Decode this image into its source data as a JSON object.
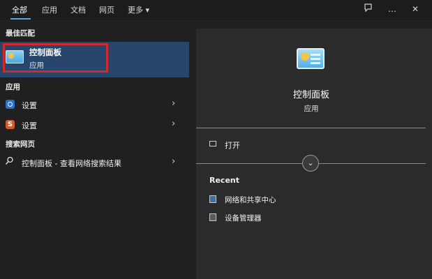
{
  "tabs": [
    {
      "label": "全部",
      "active": true
    },
    {
      "label": "应用"
    },
    {
      "label": "文档"
    },
    {
      "label": "网页"
    },
    {
      "label": "更多 ▾"
    }
  ],
  "top_icons": {
    "feedback_icon": "feedback-icon",
    "more_icon": "…",
    "close_icon": "✕"
  },
  "left": {
    "best_match_header": "最佳匹配",
    "best_match": {
      "title": "控制面板",
      "subtitle": "应用"
    },
    "apps_header": "应用",
    "apps": [
      {
        "label": "设置",
        "icon": "gear-icon"
      },
      {
        "label": "设置",
        "icon": "s-app-icon"
      }
    ],
    "web_header": "搜索网页",
    "web": {
      "label": "控制面板 - 查看网络搜索结果"
    },
    "chevron": "›"
  },
  "right": {
    "title": "控制面板",
    "subtitle": "应用",
    "open_label": "打开",
    "expand_glyph": "⌄",
    "recent_header": "Recent",
    "recent": [
      {
        "label": "网络和共享中心"
      },
      {
        "label": "设备管理器"
      }
    ]
  },
  "colors": {
    "background": "#202020",
    "panel": "#2b2b2b",
    "selection": "#28466b",
    "highlight_border": "#d02a2a",
    "accent": "#5ea3e6"
  }
}
